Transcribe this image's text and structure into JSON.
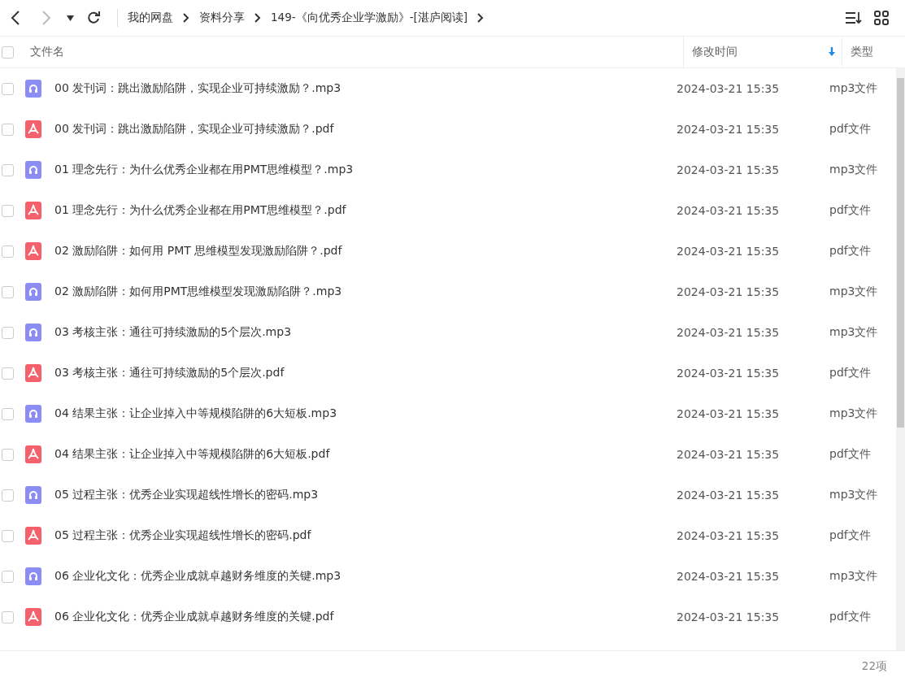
{
  "breadcrumb": [
    "我的网盘",
    "资料分享",
    "149-《向优秀企业学激励》-[湛庐阅读]"
  ],
  "table": {
    "select_all_checked": false,
    "columns": [
      "文件名",
      "修改时间",
      "类型"
    ],
    "rows": [
      {
        "kind": "mp3",
        "name": "00 发刊词：跳出激励陷阱，实现企业可持续激励？.mp3",
        "modified": "2024-03-21 15:35",
        "type": "mp3文件",
        "checked": false
      },
      {
        "kind": "pdf",
        "name": "00 发刊词：跳出激励陷阱，实现企业可持续激励？.pdf",
        "modified": "2024-03-21 15:35",
        "type": "pdf文件",
        "checked": false
      },
      {
        "kind": "mp3",
        "name": "01 理念先行：为什么优秀企业都在用PMT思维模型？.mp3",
        "modified": "2024-03-21 15:35",
        "type": "mp3文件",
        "checked": false
      },
      {
        "kind": "pdf",
        "name": "01 理念先行：为什么优秀企业都在用PMT思维模型？.pdf",
        "modified": "2024-03-21 15:35",
        "type": "pdf文件",
        "checked": false
      },
      {
        "kind": "pdf",
        "name": "02 激励陷阱：如何用 PMT 思维模型发现激励陷阱？.pdf",
        "modified": "2024-03-21 15:35",
        "type": "pdf文件",
        "checked": false
      },
      {
        "kind": "mp3",
        "name": "02 激励陷阱：如何用PMT思维模型发现激励陷阱？.mp3",
        "modified": "2024-03-21 15:35",
        "type": "mp3文件",
        "checked": false
      },
      {
        "kind": "mp3",
        "name": "03 考核主张：通往可持续激励的5个层次.mp3",
        "modified": "2024-03-21 15:35",
        "type": "mp3文件",
        "checked": false
      },
      {
        "kind": "pdf",
        "name": "03 考核主张：通往可持续激励的5个层次.pdf",
        "modified": "2024-03-21 15:35",
        "type": "pdf文件",
        "checked": false
      },
      {
        "kind": "mp3",
        "name": "04 结果主张：让企业掉入中等规模陷阱的6大短板.mp3",
        "modified": "2024-03-21 15:35",
        "type": "mp3文件",
        "checked": false
      },
      {
        "kind": "pdf",
        "name": "04 结果主张：让企业掉入中等规模陷阱的6大短板.pdf",
        "modified": "2024-03-21 15:35",
        "type": "pdf文件",
        "checked": false
      },
      {
        "kind": "mp3",
        "name": "05 过程主张：优秀企业实现超线性增长的密码.mp3",
        "modified": "2024-03-21 15:35",
        "type": "mp3文件",
        "checked": false
      },
      {
        "kind": "pdf",
        "name": "05 过程主张：优秀企业实现超线性增长的密码.pdf",
        "modified": "2024-03-21 15:35",
        "type": "pdf文件",
        "checked": false
      },
      {
        "kind": "mp3",
        "name": "06 企业化文化：优秀企业成就卓越财务维度的关键.mp3",
        "modified": "2024-03-21 15:35",
        "type": "mp3文件",
        "checked": false
      },
      {
        "kind": "pdf",
        "name": "06 企业化文化：优秀企业成就卓越财务维度的关键.pdf",
        "modified": "2024-03-21 15:35",
        "type": "pdf文件",
        "checked": false
      }
    ]
  },
  "status_bar": {
    "count": "22项"
  }
}
